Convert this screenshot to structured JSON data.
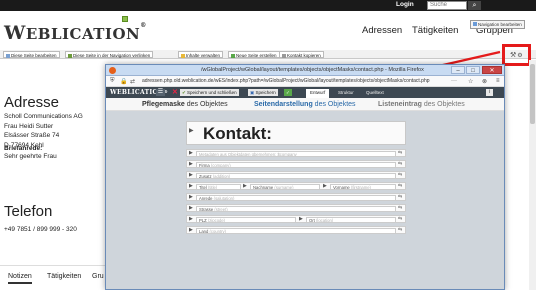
{
  "topbar": {
    "login": "Login",
    "search_placeholder": "Suche",
    "search_icon": "search-icon"
  },
  "header": {
    "logo_initial": "W",
    "logo_rest": "EBLICATION",
    "logo_mark": "®",
    "nav": [
      "Adressen",
      "Tätigkeiten",
      "Gruppen"
    ],
    "nav_tooltip": "Navigation bearbeiten"
  },
  "toolbar": {
    "buttons": [
      "Diese Seite bearbeiten",
      "Diese Seite in der Navigation verlinken",
      "Inhalte verwalten",
      "Neue Seite erstellen",
      "Kontakt kopieren"
    ],
    "right_icons": [
      "tools-icon",
      "settings-icon"
    ]
  },
  "address": {
    "heading": "Adresse",
    "lines": [
      "Scholl Communications AG",
      "Frau Heidi Sutter",
      "Elsässer Straße 74",
      "D-77694 Kehl"
    ],
    "brief_label": "Briefanrede:",
    "brief_value": "Sehr geehrte Frau"
  },
  "phone": {
    "heading": "Telefon",
    "number": "+49 7851 / 899 999 - 320"
  },
  "tabs": [
    "Notizen",
    "Tätigkeiten",
    "Gru"
  ],
  "firefox": {
    "title": "/wGlobalProject/wGlobal/layout/templates/objects/objectMasks/contact.php - Mozilla Firefox",
    "url": "adressen.php.old.weblication.de/wES/index.php?path=/wGlobalProject/wGlobal/layout/templates/objects/objectMasks/contact.php",
    "more": "···",
    "controls": {
      "min": "–",
      "max": "□",
      "close": "✕"
    },
    "bar": {
      "brand": "WEBLICATION",
      "brand_mark": "®",
      "menu": "☰",
      "close_x": "✕",
      "save_close": "Speichern und schließen",
      "save": "Speichern",
      "ok": "✓",
      "tabs": [
        "Entwurf",
        "Struktur",
        "Quelltext"
      ]
    },
    "subtabs": [
      {
        "bold": "Pflegemaske",
        "rest": " des Objektes"
      },
      {
        "bold": "Seitendarstellung",
        "rest": " des Objektes"
      },
      {
        "bold": "Listeneintrag",
        "rest": " des Objektes"
      }
    ],
    "form": {
      "title": "Kontakt:",
      "rows": [
        {
          "fields": [
            {
              "text": "Metadaten aus Objektdaten übernehmen: $company"
            }
          ]
        },
        {
          "fields": [
            {
              "text": "Firma",
              "ph": " (company)"
            }
          ]
        },
        {
          "fields": [
            {
              "text": "Zusatz",
              "ph": " (addition)"
            }
          ]
        },
        {
          "fields": [
            {
              "text": "Titel",
              "ph": " (title)"
            },
            {
              "text": "Nachname",
              "ph": " (surname)"
            },
            {
              "text": "Vorname",
              "ph": " (firstname)"
            }
          ]
        },
        {
          "fields": [
            {
              "text": "Anrede",
              "ph": " (salutation)"
            }
          ]
        },
        {
          "fields": [
            {
              "text": "Strasse",
              "ph": " (street)"
            }
          ]
        },
        {
          "fields": [
            {
              "text": "PLZ",
              "ph": " (zipcode)"
            },
            {
              "text": "Ort",
              "ph": " (location)"
            }
          ]
        },
        {
          "fields": [
            {
              "text": "Land",
              "ph": " (country)"
            }
          ]
        }
      ]
    }
  },
  "colors": {
    "highlight": "#e51a1a",
    "accent": "#2a6aa8",
    "brand_green": "#8bbf4a"
  }
}
